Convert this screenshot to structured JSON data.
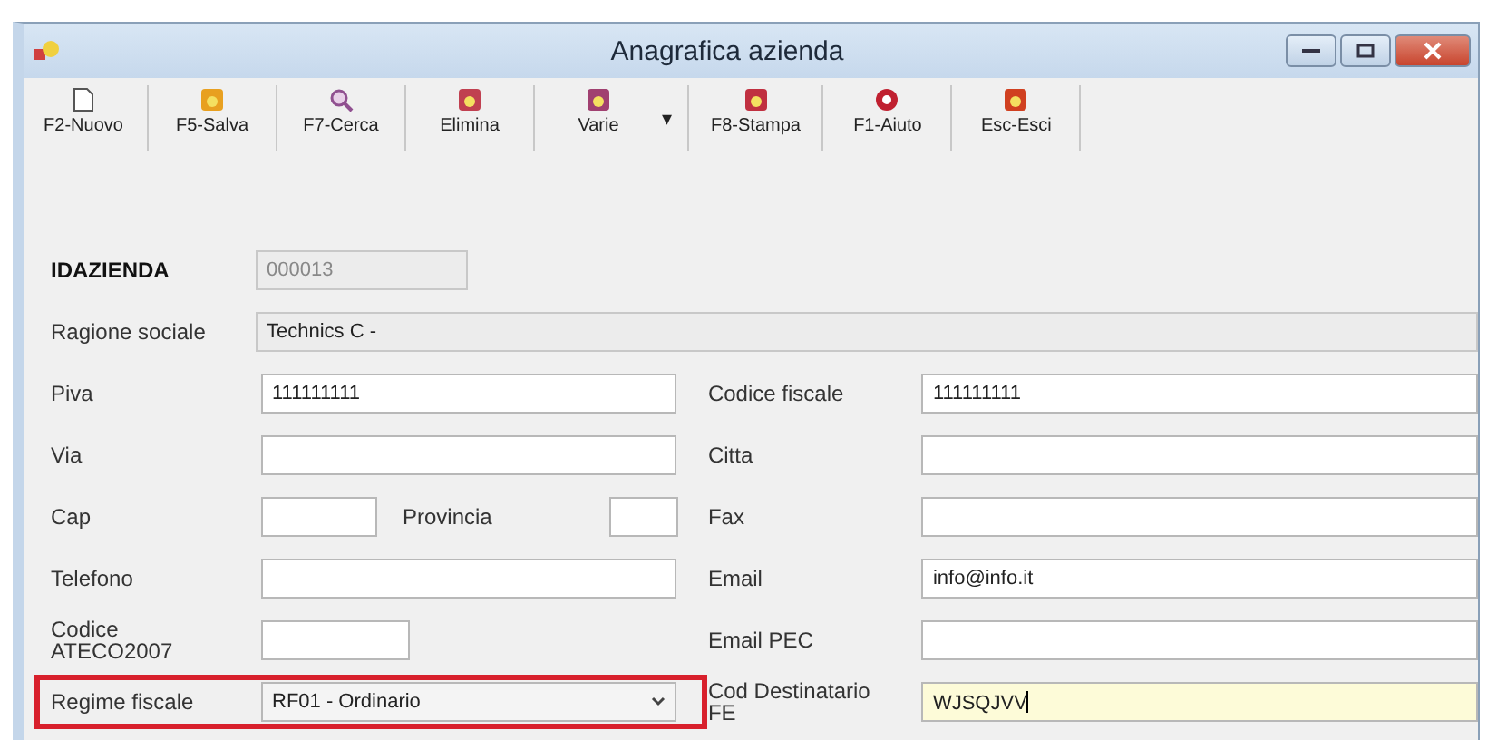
{
  "window": {
    "title": "Anagrafica azienda"
  },
  "toolbar": [
    {
      "label": "F2-Nuovo",
      "kind": "new"
    },
    {
      "label": "F5-Salva",
      "kind": "save"
    },
    {
      "label": "F7-Cerca",
      "kind": "search"
    },
    {
      "label": "Elimina",
      "kind": "delete"
    },
    {
      "label": "Varie",
      "kind": "misc",
      "menu": "▾"
    },
    {
      "label": "F8-Stampa",
      "kind": "print"
    },
    {
      "label": "F1-Aiuto",
      "kind": "help"
    },
    {
      "label": "Esc-Esci",
      "kind": "exit"
    }
  ],
  "id_field": {
    "label": "IDAZIENDA",
    "value": "000013",
    "disabled": true
  },
  "company_name": {
    "label": "Ragione sociale",
    "value": "Technics C -",
    "disabled": true
  },
  "rows": [
    {
      "left": {
        "kind": "text",
        "label": "Piva",
        "value": "111111111"
      },
      "right": {
        "label": "Codice fiscale",
        "value": "111111111",
        "focused": false
      }
    },
    {
      "left": {
        "kind": "text",
        "label": "Via"
      },
      "right": {
        "label": "Citta",
        "focused": false
      }
    },
    {
      "left": {
        "kind": "pair",
        "label": "Cap",
        "label2": "Provincia"
      },
      "right": {
        "label": "Fax",
        "focused": false
      }
    },
    {
      "left": {
        "kind": "text",
        "label": "Telefono"
      },
      "right": {
        "label": "Email",
        "value": "info@info.it",
        "focused": false
      }
    },
    {
      "left": {
        "kind": "short",
        "label": "Codice ATECO2007"
      },
      "right": {
        "label": "Email PEC",
        "focused": false
      }
    },
    {
      "left": {
        "kind": "combo",
        "label": "Regime fiscale",
        "value": "RF01 - Ordinario",
        "highlighted": true
      },
      "right": {
        "label": "Cod Destinatario FE",
        "value": "WJSQJVV",
        "focused": true
      }
    }
  ]
}
